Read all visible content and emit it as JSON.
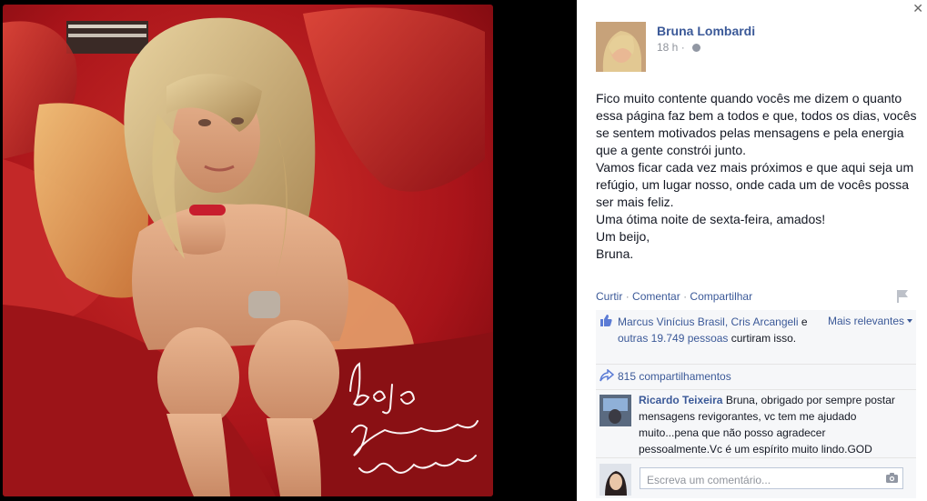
{
  "photo": {
    "alt_subject": "woman-on-red-bed",
    "signature_text": "beijo Bruna Lombardi"
  },
  "post": {
    "author": "Bruna Lombardi",
    "timestamp": "18 h",
    "privacy_icon": "globe-icon",
    "body": [
      "Fico muito contente quando vocês me dizem o quanto essa página faz bem a todos e que, todos os dias, vocês se sentem motivados pelas mensagens e pela energia que a gente constrói junto.",
      "Vamos ficar cada vez mais próximos e que aqui seja um refúgio, um lugar nosso, onde cada um de vocês possa ser mais feliz.",
      "Uma ótima noite de sexta-feira, amados!",
      "Um beijo,",
      "Bruna."
    ]
  },
  "actions": {
    "like": "Curtir",
    "comment": "Comentar",
    "share": "Compartilhar",
    "sep": "·"
  },
  "likes": {
    "names": "Marcus Vinícius Brasil, Cris Arcangeli",
    "conj": " e ",
    "others": "outras 19.749 pessoas",
    "suffix": " curtiram isso.",
    "sort_label": "Mais relevantes"
  },
  "shares": {
    "label": "815 compartilhamentos"
  },
  "comment": {
    "author": "Ricardo Teixeira",
    "text": " Bruna, obrigado por sempre postar mensagens revigorantes, vc tem me ajudado muito...pena que não posso agradecer pessoalmente.Vc é um espírito muito lindo.GOD BLESS YOU!!"
  },
  "composer": {
    "placeholder": "Escreva um comentário..."
  },
  "colors": {
    "link": "#3b5998",
    "muted": "#90949c",
    "ufi_bg": "#f6f7f9"
  }
}
